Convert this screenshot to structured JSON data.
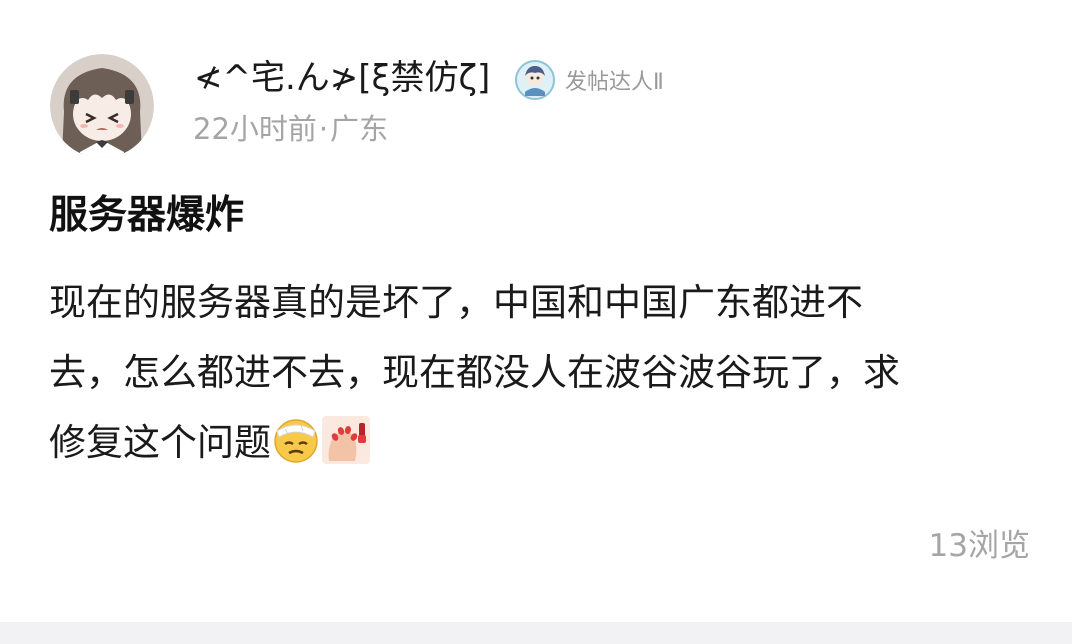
{
  "author": {
    "username": "≮^宅.ん≯[ξ禁仿ζ]",
    "badge_label": "发帖达人Ⅱ",
    "avatar_icon": "anime-girl-avatar",
    "badge_icon": "character-badge-icon"
  },
  "meta": {
    "time": "22小时前",
    "separator": "·",
    "location": "广东"
  },
  "post": {
    "title": "服务器爆炸",
    "body_lines": [
      "现在的服务器真的是坏了，中国和中国广东都进不",
      "去，怎么都进不去，现在都没人在波谷波谷玩了，求",
      "修复这个问题"
    ],
    "emojis": [
      "bandaged-face-emoji",
      "nail-polish-emoji"
    ]
  },
  "stats": {
    "views": "13浏览"
  },
  "colors": {
    "text": "#1a1a1a",
    "muted": "#a5a5a5",
    "badge_text": "#9a9a9a",
    "footer_bg": "#f2f2f4"
  }
}
